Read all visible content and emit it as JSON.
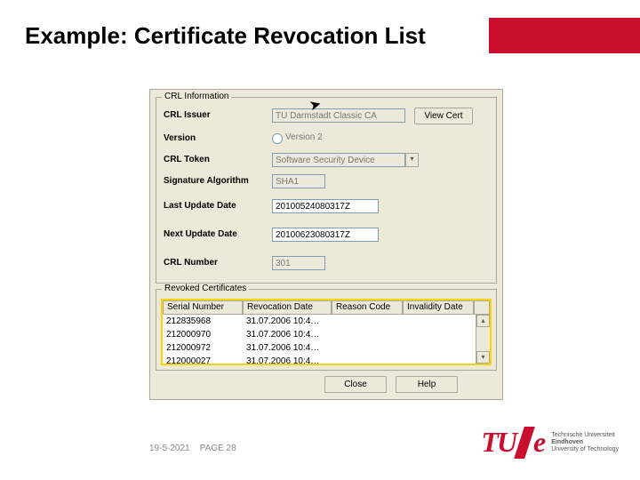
{
  "title": "Example: Certificate Revocation List",
  "footer": {
    "date": "19-5-2021",
    "page_label": "PAGE 28"
  },
  "logo": {
    "mark": "TU",
    "e": "e",
    "line1": "Technische Universiteit",
    "line2": "Eindhoven",
    "line3": "University of Technology"
  },
  "crl": {
    "info_legend": "CRL Information",
    "labels": {
      "issuer": "CRL Issuer",
      "version": "Version",
      "token": "CRL Token",
      "sigalg": "Signature Algorithm",
      "lastupd": "Last Update Date",
      "nextupd": "Next Update Date",
      "crlnum": "CRL Number"
    },
    "fields": {
      "issuer": "TU Darmstadt Classic CA",
      "version_opt": "Version 2",
      "token": "Software Security Device",
      "sigalg": "SHA1",
      "lastupd": "20100524080317Z",
      "nextupd": "20100623080317Z",
      "crlnum": "301"
    },
    "buttons": {
      "viewcert": "View Cert",
      "close": "Close",
      "help": "Help"
    }
  },
  "revoked": {
    "legend": "Revoked Certificates",
    "headers": [
      "Serial Number",
      "Revocation Date",
      "Reason Code",
      "Invalidity Date"
    ],
    "rows": [
      {
        "serial": "212835968",
        "date": "31.07.2006 10:4…"
      },
      {
        "serial": "212000970",
        "date": "31.07.2006 10:4…"
      },
      {
        "serial": "212000972",
        "date": "31.07.2006 10:4…"
      },
      {
        "serial": "212000027",
        "date": "31.07.2006 10:4…"
      }
    ]
  }
}
